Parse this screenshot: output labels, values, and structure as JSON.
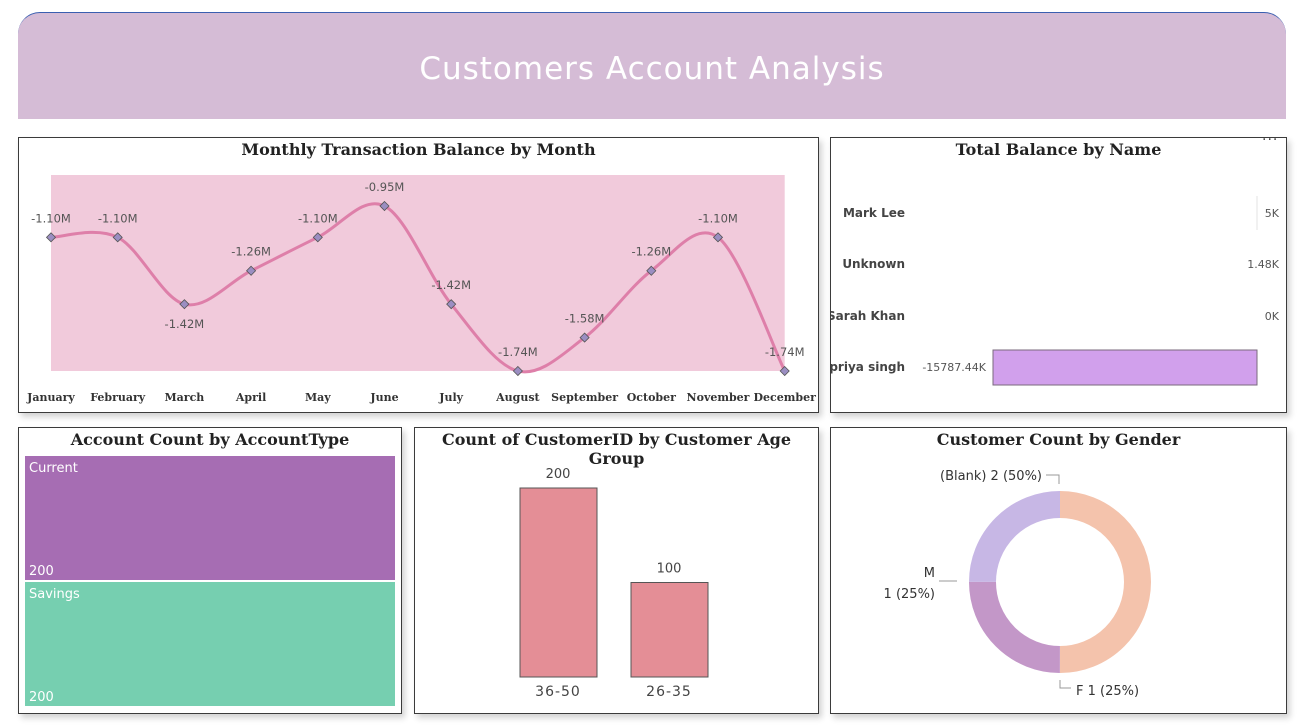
{
  "header": {
    "title": "Customers Account Analysis"
  },
  "line_panel": {
    "title": "Monthly Transaction Balance by Month"
  },
  "name_panel": {
    "title": "Total Balance by Name",
    "menu": "..."
  },
  "account_panel": {
    "title": "Account Count by AccountType"
  },
  "age_panel": {
    "title": "Count of CustomerID by Customer Age Group"
  },
  "gender_panel": {
    "title": "Customer Count by Gender"
  },
  "colors": {
    "line": "#de7fa9",
    "area": "#f1cadb",
    "marker": "#9b8ec2",
    "bar_name": "#d1a0ec",
    "current": "#a66db3",
    "savings": "#76cfb0",
    "age_bar": "#e48e96",
    "blank": "#f4c3ac",
    "m": "#c7b7e5",
    "f": "#c397c8"
  },
  "chart_data": [
    {
      "type": "area",
      "title": "Monthly Transaction Balance by Month",
      "categories": [
        "January",
        "February",
        "March",
        "April",
        "May",
        "June",
        "July",
        "August",
        "September",
        "October",
        "November",
        "December"
      ],
      "values": [
        -1.1,
        -1.1,
        -1.42,
        -1.26,
        -1.1,
        -0.95,
        -1.42,
        -1.74,
        -1.58,
        -1.26,
        -1.1,
        -1.74
      ],
      "labels": [
        "-1.10M",
        "-1.10M",
        "-1.42M",
        "-1.26M",
        "-1.10M",
        "-0.95M",
        "-1.42M",
        "-1.74M",
        "-1.58M",
        "-1.26M",
        "-1.10M",
        "-1.74M"
      ],
      "unit": "M"
    },
    {
      "type": "bar",
      "title": "Total Balance by Name",
      "orientation": "horizontal",
      "categories": [
        "Mark Lee",
        "Unknown",
        "Sarah Khan",
        "priya singh"
      ],
      "values": [
        5,
        1.48,
        0,
        -15787.44
      ],
      "labels": [
        "5K",
        "1.48K",
        "0K",
        "-15787.44K"
      ],
      "unit": "K"
    },
    {
      "type": "treemap",
      "title": "Account Count by AccountType",
      "categories": [
        "Current",
        "Savings"
      ],
      "values": [
        200,
        200
      ],
      "labels": [
        "200",
        "200"
      ]
    },
    {
      "type": "bar",
      "title": "Count of CustomerID by Customer Age Group",
      "categories": [
        "36-50",
        "26-35"
      ],
      "values": [
        200,
        100
      ],
      "labels": [
        "200",
        "100"
      ]
    },
    {
      "type": "pie",
      "title": "Customer Count by Gender",
      "categories": [
        "(Blank)",
        "F",
        "M"
      ],
      "values": [
        2,
        1,
        1
      ],
      "labels": [
        "(Blank) 2 (50%)",
        "F 1 (25%)",
        "M",
        "1 (25%)"
      ]
    }
  ]
}
